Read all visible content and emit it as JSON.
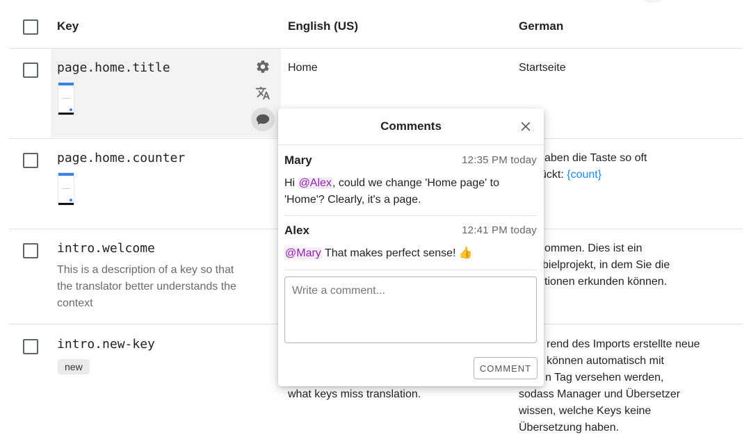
{
  "table": {
    "headers": {
      "key": "Key",
      "english": "English (US)",
      "german": "German"
    },
    "rows": [
      {
        "key": "page.home.title",
        "english": "Home",
        "german": "Startseite"
      },
      {
        "key": "page.home.counter",
        "german_line1": "aben die Taste so oft",
        "german_line2_pre": "ückt: ",
        "german_param": "{count}"
      },
      {
        "key": "intro.welcome",
        "description": "This is a description of a key so that the translator better understands the context",
        "german_line1": "ommen. Dies ist ein",
        "german_line2": "bielprojekt, in dem Sie die",
        "german_line3": "tionen erkunden können."
      },
      {
        "key": "intro.new-key",
        "badge": "new",
        "english_visible": "what keys miss translation.",
        "german_line1": "rend des Imports erstellte neue",
        "german_line2": "können automatisch mit",
        "german_line3": "n Tag versehen werden,",
        "german_line4": "sodass Manager und Übersetzer",
        "german_line5": "wissen, welche Keys keine",
        "german_line6": "Übersetzung haben."
      }
    ]
  },
  "icons": {
    "settings": "gear-icon",
    "translate": "translate-icon",
    "comment": "comment-icon",
    "close": "close-icon",
    "thumbs_up": "thumbs-up-emoji"
  },
  "comments_popover": {
    "title": "Comments",
    "comments": [
      {
        "author": "Mary",
        "time": "12:35 PM today",
        "pre": "Hi ",
        "mention": "@Alex",
        "text_rest": ", could we change 'Home page' to 'Home'? Clearly, it's a page."
      },
      {
        "author": "Alex",
        "time": "12:41 PM today",
        "mention": "@Mary",
        "text_rest": " That makes perfect sense! 👍"
      }
    ],
    "input_placeholder": "Write a comment...",
    "submit_label": "COMMENT"
  },
  "colors": {
    "mention": "#8e24aa",
    "param": "#1e88e5",
    "row_highlight": "#f3f3f3"
  }
}
